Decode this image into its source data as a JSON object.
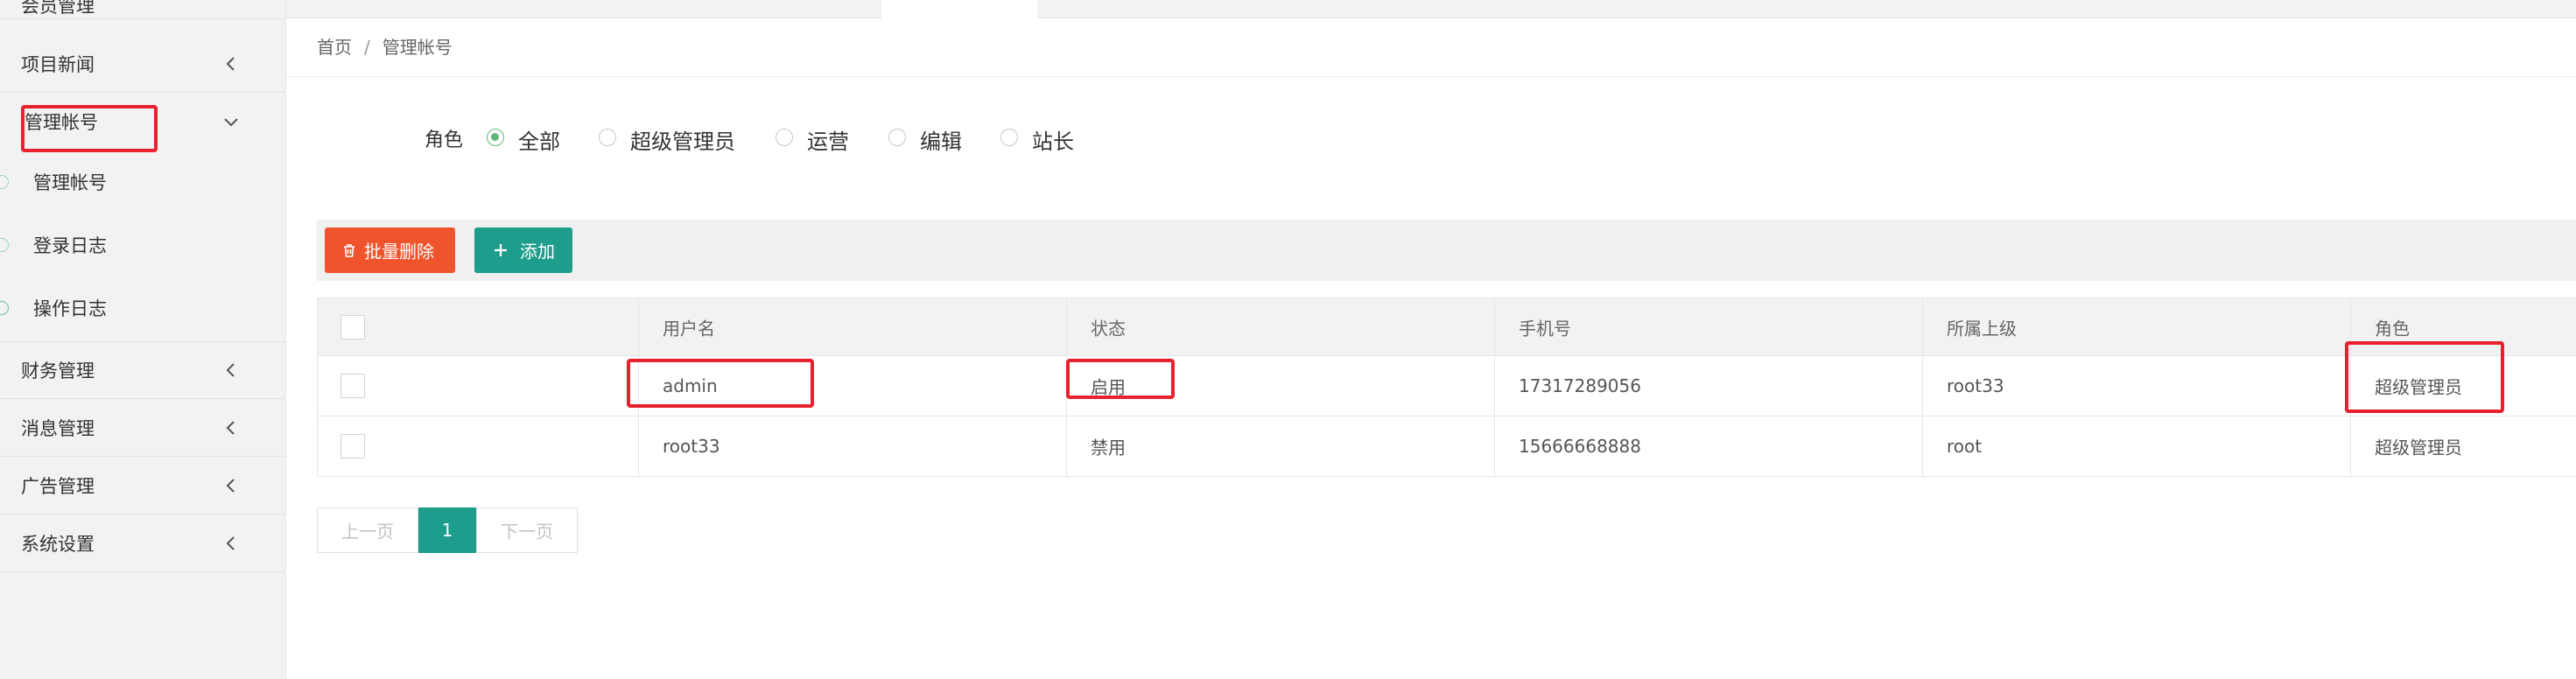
{
  "sidebar": {
    "items": [
      {
        "label": "会员管理",
        "expanded": false
      },
      {
        "label": "项目新闻",
        "expanded": false
      },
      {
        "label": "管理帐号",
        "expanded": true
      },
      {
        "label": "财务管理",
        "expanded": false
      },
      {
        "label": "消息管理",
        "expanded": false
      },
      {
        "label": "广告管理",
        "expanded": false
      },
      {
        "label": "系统设置",
        "expanded": false
      }
    ],
    "sub_items": [
      {
        "label": "管理帐号"
      },
      {
        "label": "登录日志"
      },
      {
        "label": "操作日志"
      }
    ]
  },
  "breadcrumb": {
    "home": "首页",
    "separator": "/",
    "current": "管理帐号"
  },
  "filter": {
    "label": "角色",
    "options": [
      "全部",
      "超级管理员",
      "运营",
      "编辑",
      "站长"
    ],
    "selected": "全部"
  },
  "toolbar": {
    "delete_label": "批量删除",
    "add_label": "添加"
  },
  "table": {
    "columns": [
      "用户名",
      "状态",
      "手机号",
      "所属上级",
      "角色"
    ],
    "rows": [
      {
        "username": "admin",
        "status": "启用",
        "phone": "17317289056",
        "superior": "root33",
        "role": "超级管理员"
      },
      {
        "username": "root33",
        "status": "禁用",
        "phone": "15666668888",
        "superior": "root",
        "role": "超级管理员"
      }
    ]
  },
  "pagination": {
    "prev": "上一页",
    "current": "1",
    "next": "下一页"
  },
  "colors": {
    "accent": "#1e9d8c",
    "danger": "#f0542d",
    "radio_checked": "#5fb878",
    "annotation": "#e8212e"
  }
}
